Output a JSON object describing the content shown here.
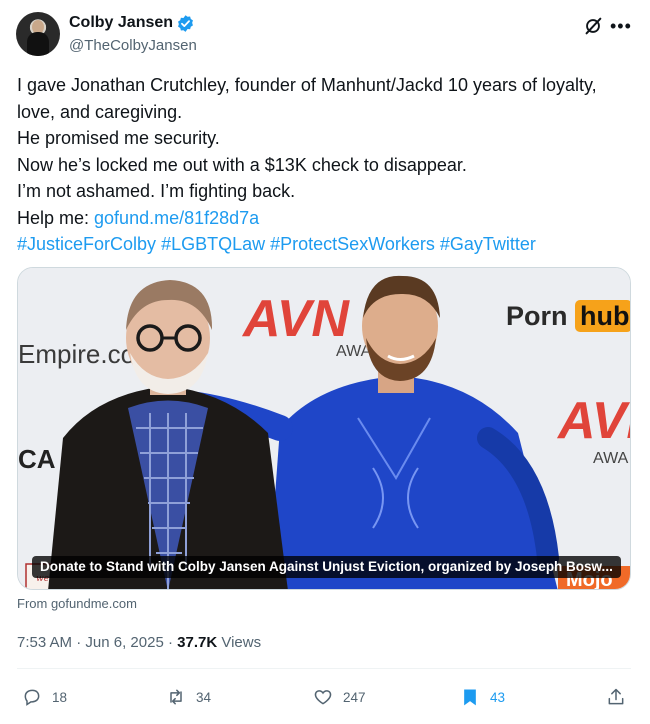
{
  "author": {
    "name": "Colby Jansen",
    "handle": "@TheColbyJansen",
    "verified": true
  },
  "icons": {
    "verified": "verified-badge-icon",
    "grok": "grok-icon",
    "more": "more-icon",
    "reply": "reply-icon",
    "repost": "repost-icon",
    "like": "like-icon",
    "bookmark": "bookmark-icon",
    "share": "share-icon"
  },
  "tweet": {
    "lines": [
      "I gave Jonathan Crutchley, founder of Manhunt/Jackd 10 years of loyalty,",
      "love, and caregiving.",
      "He promised me security.",
      "Now he’s locked me out with a $13K check to disappear.",
      "I’m not ashamed. I’m fighting back."
    ],
    "help_prefix": "Help me: ",
    "help_link": "gofund.me/81f28d7a",
    "hashtags": [
      "#JusticeForColby",
      "#LGBTQLaw",
      "#ProtectSexWorkers",
      "#GayTwitter"
    ]
  },
  "card": {
    "caption": "Donate to Stand with Colby Jansen Against Unjust Eviction, organized by Joseph Bosw...",
    "source": "From gofundme.com",
    "backdrop_text": {
      "empire": "Empire.com",
      "porn": "Porn",
      "hub": "hub",
      "avn": "AVN",
      "awa": "AWA",
      "ca": "CA",
      "mojo": "Mojo",
      "sign": "we succeed"
    }
  },
  "meta": {
    "time": "7:53 AM",
    "date": "Jun 6, 2025",
    "views_count": "37.7K",
    "views_label": "Views"
  },
  "actions": {
    "replies": "18",
    "reposts": "34",
    "likes": "247",
    "bookmarks": "43"
  },
  "colors": {
    "accent": "#1d9bf0",
    "text": "#0f1419",
    "secondary": "#536471"
  }
}
